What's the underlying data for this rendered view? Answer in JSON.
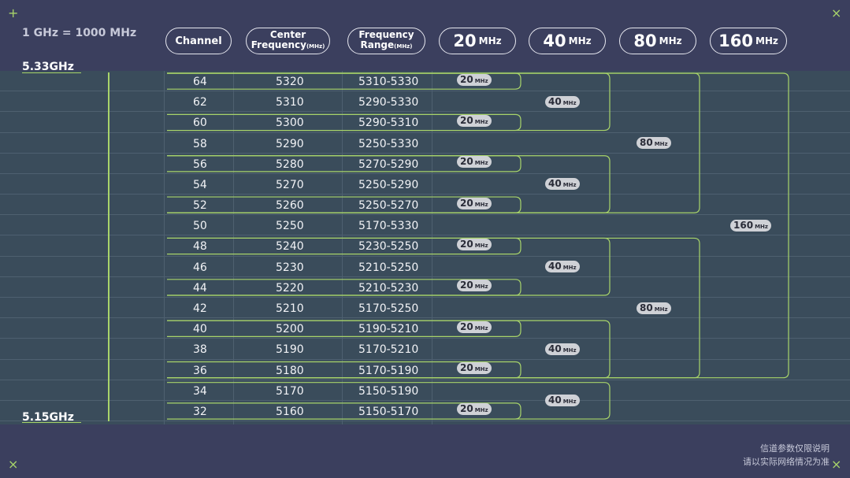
{
  "note": "1 GHz = 1000 MHz",
  "headers": {
    "channel": "Channel",
    "center_line1": "Center",
    "center_line2": "Frequency",
    "center_unit": "(MHz)",
    "range_line1": "Frequency",
    "range_line2": "Range",
    "range_unit": "(MHz)",
    "w20_num": "20",
    "w40_num": "40",
    "w80_num": "80",
    "w160_num": "160",
    "unit": "MHz"
  },
  "axis": {
    "top_label": "5.33GHz",
    "bottom_label": "5.15GHz"
  },
  "channels": [
    {
      "ch": "64",
      "center": "5320",
      "range": "5310-5330"
    },
    {
      "ch": "62",
      "center": "5310",
      "range": "5290-5330"
    },
    {
      "ch": "60",
      "center": "5300",
      "range": "5290-5310"
    },
    {
      "ch": "58",
      "center": "5290",
      "range": "5250-5330"
    },
    {
      "ch": "56",
      "center": "5280",
      "range": "5270-5290"
    },
    {
      "ch": "54",
      "center": "5270",
      "range": "5250-5290"
    },
    {
      "ch": "52",
      "center": "5260",
      "range": "5250-5270"
    },
    {
      "ch": "50",
      "center": "5250",
      "range": "5170-5330"
    },
    {
      "ch": "48",
      "center": "5240",
      "range": "5230-5250"
    },
    {
      "ch": "46",
      "center": "5230",
      "range": "5210-5250"
    },
    {
      "ch": "44",
      "center": "5220",
      "range": "5210-5230"
    },
    {
      "ch": "42",
      "center": "5210",
      "range": "5170-5250"
    },
    {
      "ch": "40",
      "center": "5200",
      "range": "5190-5210"
    },
    {
      "ch": "38",
      "center": "5190",
      "range": "5170-5210"
    },
    {
      "ch": "36",
      "center": "5180",
      "range": "5170-5190"
    },
    {
      "ch": "34",
      "center": "5170",
      "range": "5150-5190"
    },
    {
      "ch": "32",
      "center": "5160",
      "range": "5150-5170"
    }
  ],
  "badge_unit": "MHz",
  "pills_20": [
    "20",
    "20",
    "20",
    "20",
    "20",
    "20",
    "20",
    "20",
    "20"
  ],
  "pills_40": [
    "40",
    "40",
    "40",
    "40",
    "40"
  ],
  "pills_80": [
    "80",
    "80"
  ],
  "pill_160": "160",
  "footer": {
    "line1": "信道参数仅限说明",
    "line2": "请以实际网络情况为准"
  },
  "colors": {
    "background": "#3b3f5e",
    "panel": "#3a4c5b",
    "accent": "#a8d46a",
    "badge": "#cfd1d6"
  }
}
